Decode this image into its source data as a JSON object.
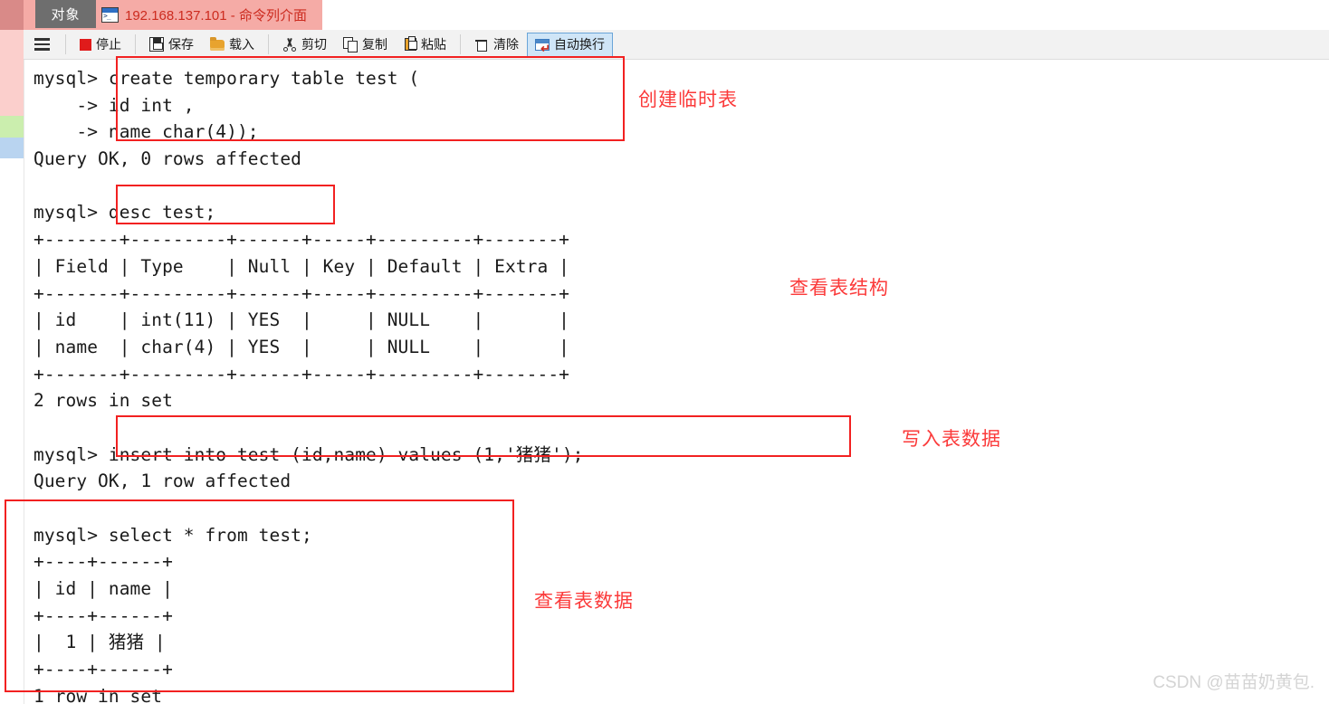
{
  "window": {
    "tabs": [
      {
        "label": "对象",
        "name": "tab-objects",
        "active": false
      },
      {
        "label": "192.168.137.101 - 命令列介面",
        "name": "tab-command-line",
        "active": true,
        "icon": "console-icon"
      }
    ]
  },
  "toolbar": {
    "menu_icon": "hamburger-menu-icon",
    "buttons": [
      {
        "label": "停止",
        "icon": "stop-icon",
        "active": false
      },
      {
        "label": "保存",
        "icon": "save-icon",
        "active": false
      },
      {
        "label": "载入",
        "icon": "folder-open-icon",
        "active": false
      },
      {
        "label": "剪切",
        "icon": "scissors-icon",
        "active": false
      },
      {
        "label": "复制",
        "icon": "copy-icon",
        "active": false
      },
      {
        "label": "粘贴",
        "icon": "paste-icon",
        "active": false
      },
      {
        "label": "清除",
        "icon": "trash-icon",
        "active": false
      },
      {
        "label": "自动换行",
        "icon": "word-wrap-icon",
        "active": true
      }
    ]
  },
  "terminal": {
    "lines": [
      "mysql> create temporary table test (",
      "    -> id int ,",
      "    -> name char(4));",
      "Query OK, 0 rows affected",
      "",
      "mysql> desc test;",
      "+-------+---------+------+-----+---------+-------+",
      "| Field | Type    | Null | Key | Default | Extra |",
      "+-------+---------+------+-----+---------+-------+",
      "| id    | int(11) | YES  |     | NULL    |       |",
      "| name  | char(4) | YES  |     | NULL    |       |",
      "+-------+---------+------+-----+---------+-------+",
      "2 rows in set",
      "",
      "mysql> insert into test (id,name) values (1,'猪猪');",
      "Query OK, 1 row affected",
      "",
      "mysql> select * from test;",
      "+----+------+",
      "| id | name |",
      "+----+------+",
      "|  1 | 猪猪 |",
      "+----+------+",
      "1 row in set"
    ]
  },
  "annotations": [
    {
      "label": "创建临时表",
      "name": "annotation-create-temp-table"
    },
    {
      "label": "查看表结构",
      "name": "annotation-view-table-structure"
    },
    {
      "label": "写入表数据",
      "name": "annotation-insert-table-data"
    },
    {
      "label": "查看表数据",
      "name": "annotation-view-table-data"
    }
  ],
  "watermark": {
    "text": "CSDN @苗苗奶黄包."
  },
  "colors": {
    "tab_active_bg": "#f5aba6",
    "tab_active_text": "#cc2b1f",
    "annotation_red": "#fb3a3a",
    "box_red": "#f22121",
    "toolbar_bg": "#f2f2f2",
    "active_button_bg": "#cfe5f7"
  }
}
